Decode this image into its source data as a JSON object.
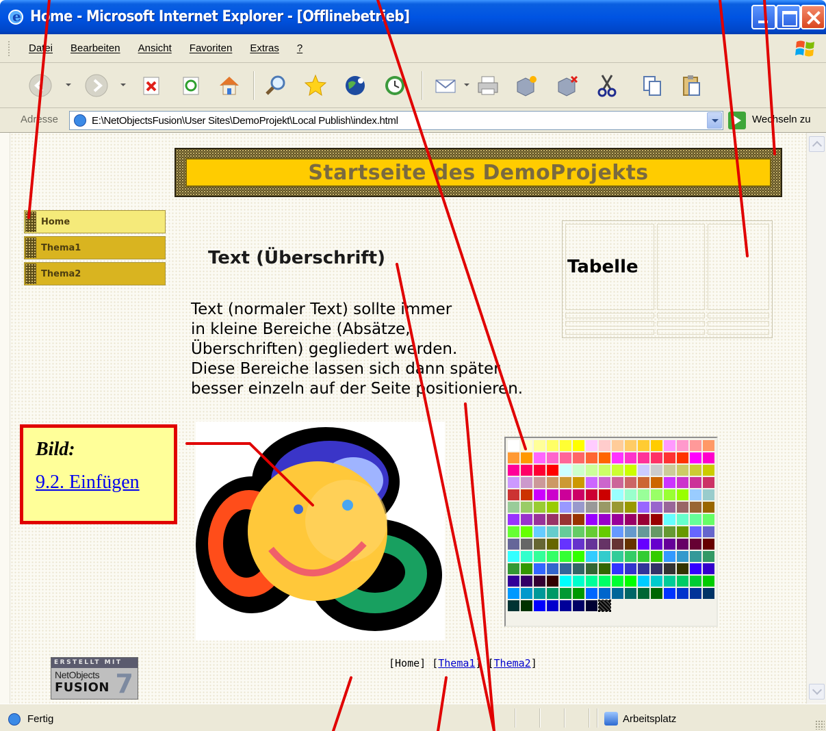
{
  "window": {
    "title": "Home - Microsoft Internet Explorer - [Offlinebetrieb]"
  },
  "menu": {
    "items": [
      "Datei",
      "Bearbeiten",
      "Ansicht",
      "Favoriten",
      "Extras",
      "?"
    ]
  },
  "toolbar": {
    "icons": [
      "back-icon",
      "forward-icon",
      "stop-icon",
      "refresh-icon",
      "home-icon",
      "search-icon",
      "favorites-icon",
      "media-icon",
      "history-icon",
      "mail-icon",
      "print-icon",
      "add-component-icon",
      "remove-component-icon",
      "cut-icon",
      "copy-icon",
      "paste-icon"
    ]
  },
  "address": {
    "label": "Adresse",
    "url": "E:\\NetObjectsFusion\\User Sites\\DemoProjekt\\Local Publish\\index.html",
    "go_label": "Wechseln zu"
  },
  "page": {
    "banner_title": "Startseite des DemoProjekts",
    "nav": [
      "Home",
      "Thema1",
      "Thema2"
    ],
    "heading": "Text (Überschrift)",
    "paragraph_lines": [
      "Text (normaler Text) sollte immer",
      "in kleine Bereiche (Absätze,",
      "Überschriften) gegliedert werden.",
      "Diese Bereiche lassen sich dann später",
      "besser einzeln auf der Seite positionieren."
    ],
    "table_header": "Tabelle",
    "callout": {
      "title": "Bild:",
      "link": "9.2. Einfügen"
    },
    "palette_colors": [
      "#ffffff",
      "#ffffcc",
      "#ffff99",
      "#ffff66",
      "#ffff33",
      "#ffff00",
      "#ffccff",
      "#ffcccc",
      "#ffcc99",
      "#ffcc66",
      "#ffcc33",
      "#ffcc00",
      "#ff99ff",
      "#ff99cc",
      "#ff9999",
      "#ff9966",
      "#ff9933",
      "#ff9900",
      "#ff66ff",
      "#ff66cc",
      "#ff6699",
      "#ff6666",
      "#ff6633",
      "#ff6600",
      "#ff33ff",
      "#ff33cc",
      "#ff3399",
      "#ff3366",
      "#ff3333",
      "#ff3300",
      "#ff00ff",
      "#ff00cc",
      "#ff0099",
      "#ff0066",
      "#ff0033",
      "#ff0000",
      "#ccffff",
      "#ccffcc",
      "#ccff99",
      "#ccff66",
      "#ccff33",
      "#ccff00",
      "#ccccff",
      "#cccccc",
      "#cccc99",
      "#cccc66",
      "#cccc33",
      "#cccc00",
      "#cc99ff",
      "#cc99cc",
      "#cc9999",
      "#cc9966",
      "#cc9933",
      "#cc9900",
      "#cc66ff",
      "#cc66cc",
      "#cc6699",
      "#cc6666",
      "#cc6633",
      "#cc6600",
      "#cc33ff",
      "#cc33cc",
      "#cc3399",
      "#cc3366",
      "#cc3333",
      "#cc3300",
      "#cc00ff",
      "#cc00cc",
      "#cc0099",
      "#cc0066",
      "#cc0033",
      "#cc0000",
      "#99ffff",
      "#99ffcc",
      "#99ff99",
      "#99ff66",
      "#99ff33",
      "#99ff00",
      "#99ccff",
      "#99cccc",
      "#99cc99",
      "#99cc66",
      "#99cc33",
      "#99cc00",
      "#9999ff",
      "#9999cc",
      "#999999",
      "#999966",
      "#999933",
      "#999900",
      "#9966ff",
      "#9966cc",
      "#996699",
      "#996666",
      "#996633",
      "#996600",
      "#9933ff",
      "#9933cc",
      "#993399",
      "#993366",
      "#993333",
      "#993300",
      "#9900ff",
      "#9900cc",
      "#990099",
      "#990066",
      "#990033",
      "#990000",
      "#66ffff",
      "#66ffcc",
      "#66ff99",
      "#66ff66",
      "#66ff33",
      "#66ff00",
      "#66ccff",
      "#66cccc",
      "#66cc99",
      "#66cc66",
      "#66cc33",
      "#66cc00",
      "#6699ff",
      "#6699cc",
      "#669999",
      "#669966",
      "#669933",
      "#669900",
      "#6666ff",
      "#6666cc",
      "#666699",
      "#666666",
      "#666633",
      "#666600",
      "#6633ff",
      "#6633cc",
      "#663399",
      "#663366",
      "#663333",
      "#663300",
      "#6600ff",
      "#6600cc",
      "#660099",
      "#660066",
      "#660033",
      "#660000",
      "#33ffff",
      "#33ffcc",
      "#33ff99",
      "#33ff66",
      "#33ff33",
      "#33ff00",
      "#33ccff",
      "#33cccc",
      "#33cc99",
      "#33cc66",
      "#33cc33",
      "#33cc00",
      "#3399ff",
      "#3399cc",
      "#339999",
      "#339966",
      "#339933",
      "#339900",
      "#3366ff",
      "#3366cc",
      "#336699",
      "#336666",
      "#336633",
      "#336600",
      "#3333ff",
      "#3333cc",
      "#333399",
      "#333366",
      "#333333",
      "#333300",
      "#3300ff",
      "#3300cc",
      "#330099",
      "#330066",
      "#330033",
      "#330000",
      "#00ffff",
      "#00ffcc",
      "#00ff99",
      "#00ff66",
      "#00ff33",
      "#00ff00",
      "#00ccff",
      "#00cccc",
      "#00cc99",
      "#00cc66",
      "#00cc33",
      "#00cc00",
      "#0099ff",
      "#0099cc",
      "#009999",
      "#009966",
      "#009933",
      "#009900",
      "#0066ff",
      "#0066cc",
      "#006699",
      "#006666",
      "#006633",
      "#006600",
      "#0033ff",
      "#0033cc",
      "#003399",
      "#003366",
      "#003333",
      "#003300",
      "#0000ff",
      "#0000cc",
      "#000099",
      "#000066",
      "#000033"
    ],
    "badge": {
      "line1": "ERSTELLT MIT",
      "line2": "NetObjects",
      "line3": "FUSION",
      "version": "7"
    },
    "footer_nav": {
      "open": "[",
      "home": "Home",
      "close_open": "] [",
      "thema1": "Thema1",
      "thema2": "Thema2",
      "close": "]"
    }
  },
  "status": {
    "text": "Fertig",
    "zone": "Arbeitsplatz"
  },
  "colors": {
    "annotation_red": "#e00000",
    "banner_yellow": "#ffcc00",
    "nav_gold": "#d9b420"
  }
}
